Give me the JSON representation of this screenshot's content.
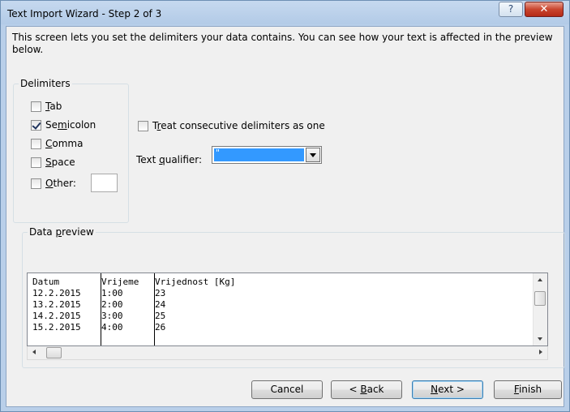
{
  "window": {
    "title": "Text Import Wizard - Step 2 of 3",
    "help_glyph": "?",
    "close_glyph": "✕"
  },
  "intro": "This screen lets you set the delimiters your data contains.  You can see how your text is affected in the preview below.",
  "delimiters": {
    "group_label": "Delimiters",
    "items": [
      {
        "label_pre": "",
        "label_key": "T",
        "label_post": "ab",
        "checked": false
      },
      {
        "label_pre": "Se",
        "label_key": "m",
        "label_post": "icolon",
        "checked": true
      },
      {
        "label_pre": "",
        "label_key": "C",
        "label_post": "omma",
        "checked": false
      },
      {
        "label_pre": "",
        "label_key": "S",
        "label_post": "pace",
        "checked": false
      },
      {
        "label_pre": "",
        "label_key": "O",
        "label_post": "ther:",
        "checked": false
      }
    ],
    "other_value": ""
  },
  "consecutive": {
    "label_pre": "T",
    "label_key": "r",
    "label_post": "eat consecutive delimiters as one",
    "checked": false
  },
  "qualifier": {
    "label_pre": "Text ",
    "label_key": "q",
    "label_post": "ualifier:",
    "value": "\""
  },
  "preview": {
    "group_label_pre": "Data ",
    "group_label_key": "p",
    "group_label_post": "review",
    "columns": [
      [
        "Datum",
        "12.2.2015",
        "13.2.2015",
        "14.2.2015",
        "15.2.2015"
      ],
      [
        "Vrijeme",
        "1:00",
        "2:00",
        "3:00",
        "4:00"
      ],
      [
        "Vrijednost [Kg]",
        "23",
        "24",
        "25",
        "26"
      ]
    ]
  },
  "buttons": {
    "cancel": "Cancel",
    "back_pre": "< ",
    "back_key": "B",
    "back_post": "ack",
    "next_pre": "",
    "next_key": "N",
    "next_post": "ext >",
    "finish_pre": "",
    "finish_key": "F",
    "finish_post": "inish"
  },
  "colors": {
    "selection": "#3399ff",
    "dialog_bg": "#f0f0f0",
    "close_red": "#c9452e"
  }
}
